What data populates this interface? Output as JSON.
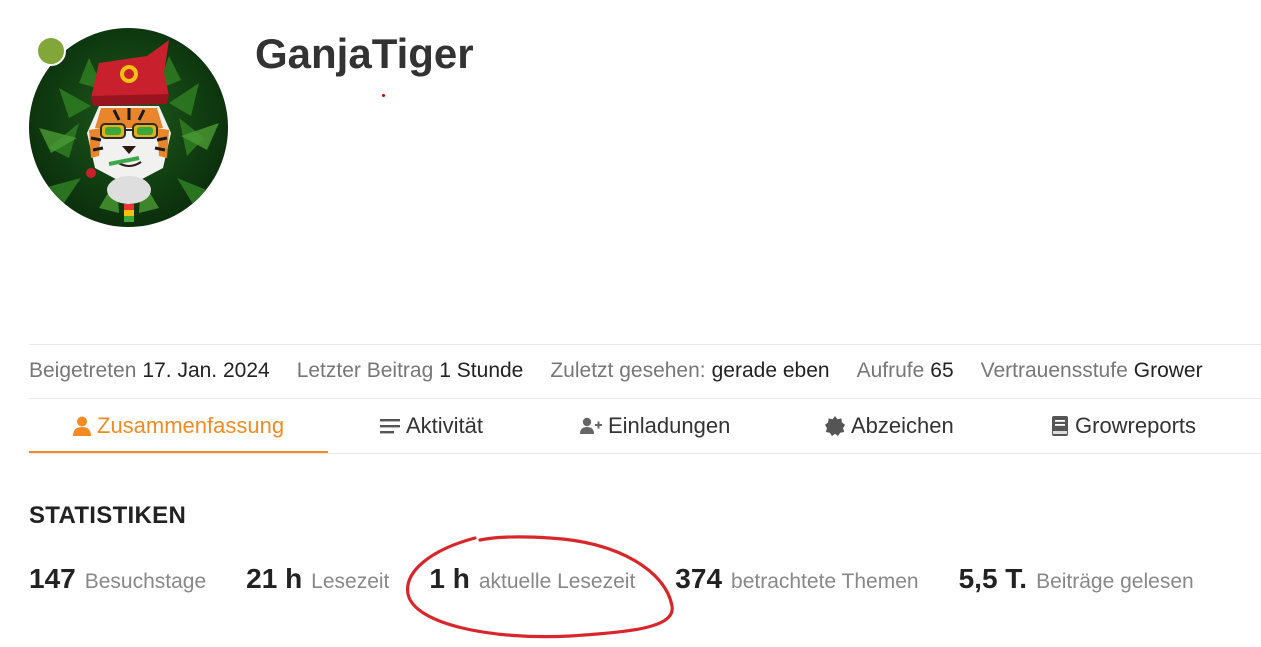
{
  "profile": {
    "username": "GanjaTiger",
    "status": "online"
  },
  "meta": {
    "joined_label": "Beigetreten",
    "joined_value": "17. Jan. 2024",
    "last_post_label": "Letzter Beitrag",
    "last_post_value": "1 Stunde",
    "last_seen_label": "Zuletzt gesehen:",
    "last_seen_value": "gerade eben",
    "views_label": "Aufrufe",
    "views_value": "65",
    "trust_label": "Vertrauensstufe",
    "trust_value": "Grower"
  },
  "tabs": [
    {
      "label": "Zusammenfassung",
      "icon": "user-icon",
      "active": true
    },
    {
      "label": "Aktivität",
      "icon": "list-icon",
      "active": false
    },
    {
      "label": "Einladungen",
      "icon": "user-plus-icon",
      "active": false
    },
    {
      "label": "Abzeichen",
      "icon": "badge-icon",
      "active": false
    },
    {
      "label": "Growreports",
      "icon": "book-icon",
      "active": false
    }
  ],
  "stats": {
    "heading": "STATISTIKEN",
    "items": [
      {
        "value": "147",
        "label": "Besuchstage"
      },
      {
        "value": "21 h",
        "label": "Lesezeit"
      },
      {
        "value": "1 h",
        "label": "aktuelle Lesezeit"
      },
      {
        "value": "374",
        "label": "betrachtete Themen"
      },
      {
        "value": "5,5 T.",
        "label": "Beiträge gelesen"
      }
    ]
  },
  "colors": {
    "accent": "#f28b23",
    "online": "#83a63a",
    "annotation": "#d9262b",
    "muted_text": "#777777"
  }
}
